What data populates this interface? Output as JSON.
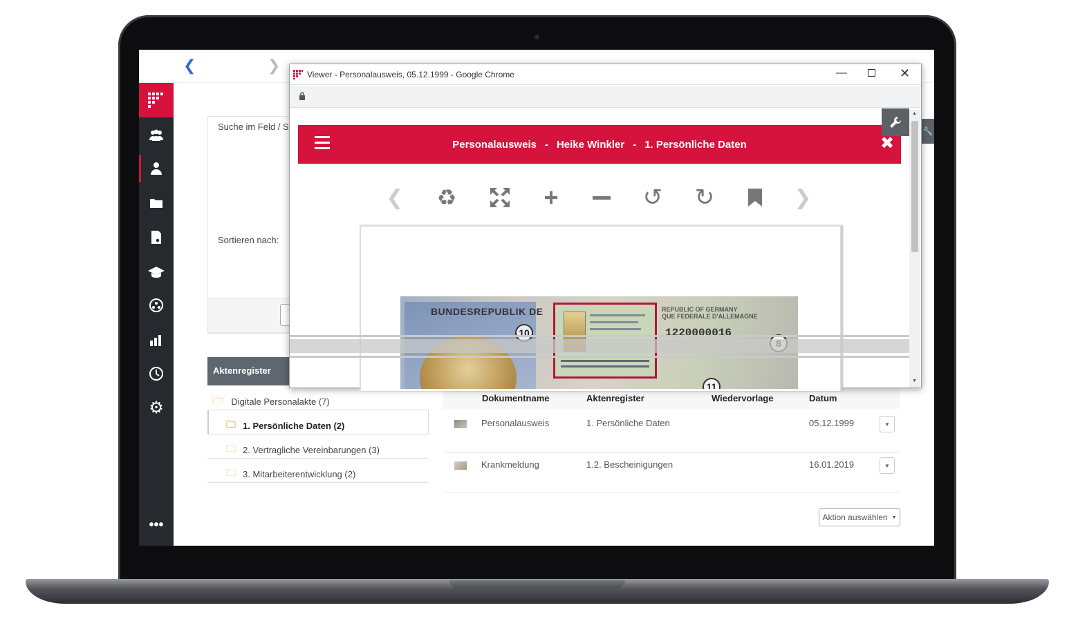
{
  "viewer": {
    "window_title": "Viewer - Personalausweis, 05.12.1999 - Google Chrome",
    "header": {
      "doc_type": "Personalausweis",
      "sep1": "-",
      "person": "Heike Winkler",
      "sep2": "-",
      "register": "1. Persönliche Daten"
    },
    "card_text": {
      "country": "BUNDESREPUBLIK DE",
      "country_alt": "REPUBLIC OF GERMANY",
      "country_fr": "QUE FEDERALE D'ALLEMAGNE",
      "number": "1220000016",
      "marker_10": "10",
      "marker_8": "8",
      "marker_11": "11"
    }
  },
  "search": {
    "label": "Suche im Feld / S",
    "sort_label": "Sortieren nach:"
  },
  "tree": {
    "header": "Aktenregister",
    "root": "Digitale Personalakte (7)",
    "items": [
      {
        "label": "1. Persönliche Daten (2)"
      },
      {
        "label": "2. Vertragliche Vereinbarungen (3)"
      },
      {
        "label": "3. Mitarbeiterentwicklung (2)"
      }
    ]
  },
  "table": {
    "columns": [
      "Dokumentname",
      "Aktenregister",
      "Wiedervorlage",
      "Datum"
    ],
    "rows": [
      {
        "name": "Personalausweis",
        "register": "1. Persönliche Daten",
        "wiedervorlage": "",
        "date": "05.12.1999"
      },
      {
        "name": "Krankmeldung",
        "register": "1.2. Bescheinigungen",
        "wiedervorlage": "",
        "date": "16.01.2019"
      }
    ],
    "action_button": "Aktion auswählen"
  },
  "colors": {
    "brand": "#d5133d",
    "sidebar": "#262a2e",
    "header_gray": "#5e6770"
  },
  "icons": {
    "sidebar": [
      "users-icon",
      "person-icon",
      "folder-icon",
      "document-search-icon",
      "graduation-cap-icon",
      "network-icon",
      "bar-chart-icon",
      "clock-icon",
      "gear-icon",
      "more-icon"
    ],
    "toolbar": [
      "prev-icon",
      "recycle-icon",
      "fit-icon",
      "zoom-in-icon",
      "zoom-out-icon",
      "rotate-left-icon",
      "rotate-right-icon",
      "bookmark-icon",
      "next-icon"
    ]
  }
}
